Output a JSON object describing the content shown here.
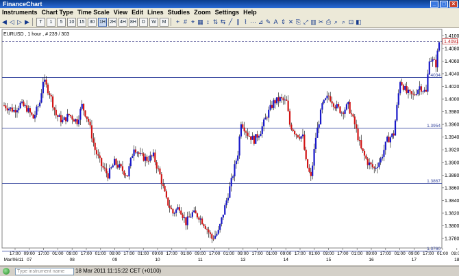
{
  "window": {
    "title": "FinanceChart"
  },
  "menu": [
    "Instruments",
    "Chart Type",
    "Time Scale",
    "View",
    "Edit",
    "Lines",
    "Studies",
    "Zoom",
    "Settings",
    "Help"
  ],
  "toolbar": {
    "timescales": [
      "T",
      "1",
      "5",
      "10",
      "15",
      "30",
      "1H",
      "2H",
      "4H",
      "8H",
      "D",
      "W",
      "M"
    ],
    "selected_timescale": "1H"
  },
  "chart": {
    "header": "EURUSD , 1 hour , # 239 / 303",
    "y_ticks": [
      "1.4100",
      "1.4080",
      "1.4060",
      "1.4040",
      "1.4020",
      "1.4000",
      "1.3980",
      "1.3960",
      "1.3940",
      "1.3920",
      "1.3900",
      "1.3880",
      "1.3860",
      "1.3840",
      "1.3820",
      "1.3800",
      "1.3780"
    ],
    "x_time_labels": [
      "17:00",
      "09:00",
      "17:00",
      "01:00",
      "09:00",
      "17:00",
      "01:00",
      "09:00",
      "17:00",
      "01:00",
      "09:00",
      "17:00",
      "01:00",
      "09:00",
      "17:00",
      "01:00",
      "09:00",
      "17:00",
      "01:00",
      "09:00",
      "17:00",
      "01:00",
      "09:00",
      "17:00",
      "01:00",
      "09:00",
      "17:00",
      "01:00",
      "09:00",
      "17:00",
      "01:00",
      "09:00",
      "17:00",
      "01:00",
      "09:00",
      "17:00",
      "01:00",
      "09:00"
    ],
    "x_day_labels": [
      {
        "label": "Mar/06/11",
        "col": 0
      },
      {
        "label": "07",
        "col": 1
      },
      {
        "label": "08",
        "col": 4
      },
      {
        "label": "09",
        "col": 7
      },
      {
        "label": "10",
        "col": 10
      },
      {
        "label": "11",
        "col": 13
      },
      {
        "label": "13",
        "col": 16
      },
      {
        "label": "14",
        "col": 19
      },
      {
        "label": "15",
        "col": 22
      },
      {
        "label": "16",
        "col": 25
      },
      {
        "label": "17",
        "col": 28
      },
      {
        "label": "18",
        "col": 31
      }
    ],
    "levels": [
      {
        "label": "1.4034",
        "value": 1.4034
      },
      {
        "label": "1.3954",
        "value": 1.3954
      },
      {
        "label": "1.3867",
        "value": 1.3867
      },
      {
        "label": "1.3760",
        "value": 1.376
      }
    ],
    "current_price": {
      "label": "1.4091",
      "value": 1.4091
    },
    "colors": {
      "up": "#1818c8",
      "down": "#d21414",
      "level": "#3a4aa0",
      "price_line": "#303080"
    }
  },
  "chart_data": {
    "type": "candlestick",
    "symbol": "EURUSD",
    "interval": "1 hour",
    "ylim": [
      1.3765,
      1.411
    ],
    "levels": [
      1.4034,
      1.3954,
      1.3867,
      1.376
    ],
    "current_price": 1.4091,
    "path": [
      {
        "t": 0,
        "v": 1.399
      },
      {
        "t": 6,
        "v": 1.3982
      },
      {
        "t": 10,
        "v": 1.3992
      },
      {
        "t": 14,
        "v": 1.3985
      },
      {
        "t": 18,
        "v": 1.397
      },
      {
        "t": 22,
        "v": 1.3995
      },
      {
        "t": 24,
        "v": 1.403
      },
      {
        "t": 28,
        "v": 1.401
      },
      {
        "t": 32,
        "v": 1.3975
      },
      {
        "t": 36,
        "v": 1.3965
      },
      {
        "t": 40,
        "v": 1.3975
      },
      {
        "t": 45,
        "v": 1.3965
      },
      {
        "t": 48,
        "v": 1.399
      },
      {
        "t": 52,
        "v": 1.3965
      },
      {
        "t": 56,
        "v": 1.392
      },
      {
        "t": 60,
        "v": 1.3895
      },
      {
        "t": 64,
        "v": 1.388
      },
      {
        "t": 68,
        "v": 1.39
      },
      {
        "t": 72,
        "v": 1.389
      },
      {
        "t": 76,
        "v": 1.388
      },
      {
        "t": 80,
        "v": 1.3925
      },
      {
        "t": 84,
        "v": 1.391
      },
      {
        "t": 88,
        "v": 1.3905
      },
      {
        "t": 92,
        "v": 1.391
      },
      {
        "t": 96,
        "v": 1.388
      },
      {
        "t": 100,
        "v": 1.384
      },
      {
        "t": 104,
        "v": 1.382
      },
      {
        "t": 108,
        "v": 1.383
      },
      {
        "t": 112,
        "v": 1.3805
      },
      {
        "t": 116,
        "v": 1.382
      },
      {
        "t": 120,
        "v": 1.3815
      },
      {
        "t": 124,
        "v": 1.38
      },
      {
        "t": 128,
        "v": 1.378
      },
      {
        "t": 132,
        "v": 1.379
      },
      {
        "t": 136,
        "v": 1.383
      },
      {
        "t": 140,
        "v": 1.387
      },
      {
        "t": 144,
        "v": 1.3915
      },
      {
        "t": 146,
        "v": 1.3965
      },
      {
        "t": 150,
        "v": 1.3945
      },
      {
        "t": 154,
        "v": 1.3935
      },
      {
        "t": 158,
        "v": 1.395
      },
      {
        "t": 162,
        "v": 1.3975
      },
      {
        "t": 166,
        "v": 1.3995
      },
      {
        "t": 170,
        "v": 1.4
      },
      {
        "t": 174,
        "v": 1.3995
      },
      {
        "t": 176,
        "v": 1.396
      },
      {
        "t": 180,
        "v": 1.3945
      },
      {
        "t": 184,
        "v": 1.394
      },
      {
        "t": 186,
        "v": 1.39
      },
      {
        "t": 189,
        "v": 1.3875
      },
      {
        "t": 192,
        "v": 1.394
      },
      {
        "t": 196,
        "v": 1.399
      },
      {
        "t": 200,
        "v": 1.4005
      },
      {
        "t": 204,
        "v": 1.399
      },
      {
        "t": 208,
        "v": 1.398
      },
      {
        "t": 212,
        "v": 1.399
      },
      {
        "t": 216,
        "v": 1.396
      },
      {
        "t": 220,
        "v": 1.392
      },
      {
        "t": 224,
        "v": 1.39
      },
      {
        "t": 228,
        "v": 1.389
      },
      {
        "t": 232,
        "v": 1.3905
      },
      {
        "t": 236,
        "v": 1.3935
      },
      {
        "t": 240,
        "v": 1.3945
      },
      {
        "t": 244,
        "v": 1.403
      },
      {
        "t": 248,
        "v": 1.401
      },
      {
        "t": 252,
        "v": 1.4005
      },
      {
        "t": 256,
        "v": 1.402
      },
      {
        "t": 260,
        "v": 1.401
      },
      {
        "t": 262,
        "v": 1.4065
      },
      {
        "t": 266,
        "v": 1.4055
      },
      {
        "t": 268,
        "v": 1.409
      }
    ]
  }
}
